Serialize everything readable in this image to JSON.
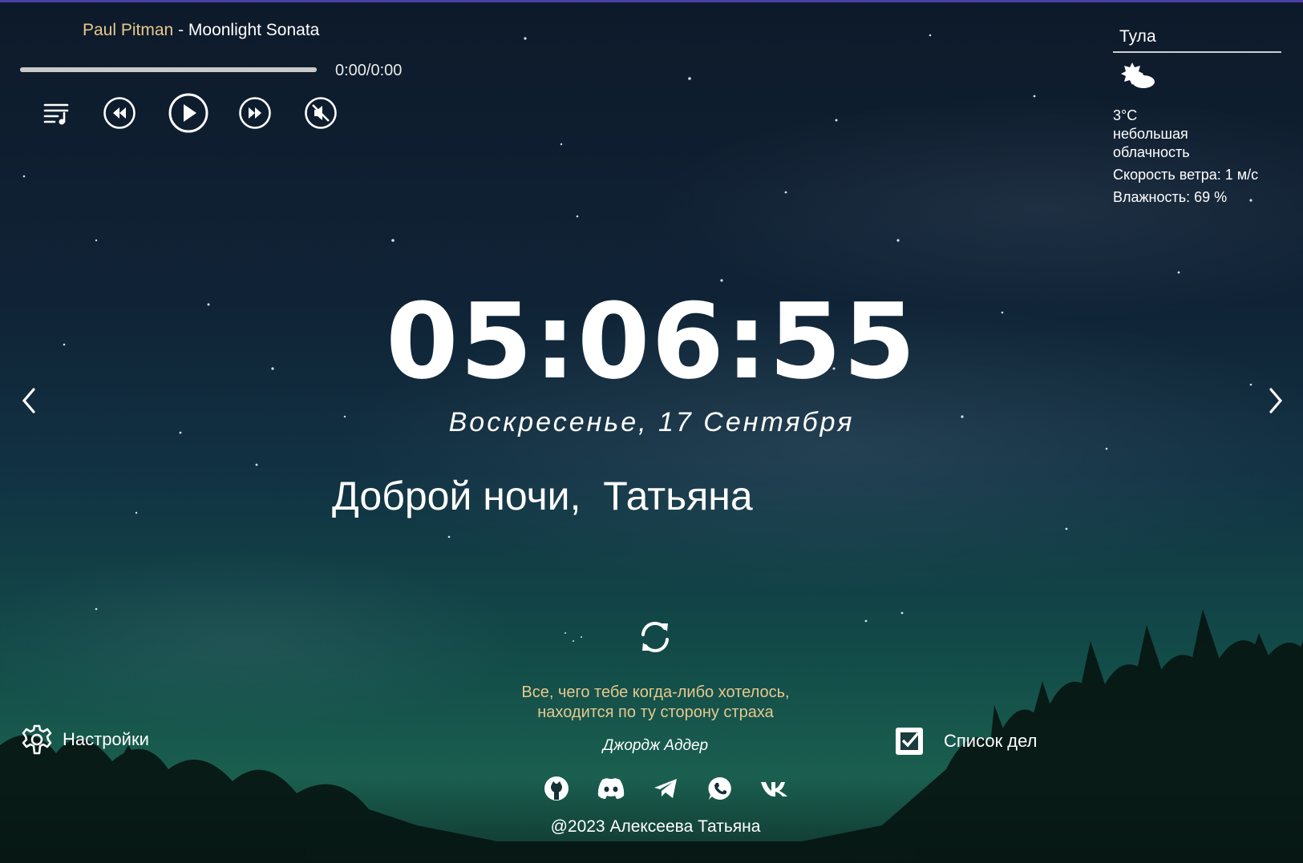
{
  "player": {
    "artist": "Paul Pitman",
    "separator": " - ",
    "song": "Moonlight Sonata",
    "time": "0:00/0:00",
    "progress_fraction": 1.0,
    "icons": [
      "playlist-icon",
      "rewind-icon",
      "play-icon",
      "fast-forward-icon",
      "mute-icon"
    ]
  },
  "weather": {
    "city": "Тула",
    "icon": "partly-cloudy-night-icon",
    "temperature": "3°C",
    "description_line1": "небольшая",
    "description_line2": "облачность",
    "wind": "Скорость ветра: 1 м/с",
    "humidity": "Влажность: 69 %"
  },
  "clock": {
    "time": "05:06:55",
    "date": "Воскресенье, 17 Сентября"
  },
  "greeting": {
    "text": "Доброй ночи,  Татьяна"
  },
  "slider": {
    "prev_icon": "chevron-left-icon",
    "next_icon": "chevron-right-icon"
  },
  "quote": {
    "line1": "Все, чего тебе когда-либо хотелось,",
    "line2": "находится по ту сторону страха",
    "author": "Джордж Аддер",
    "refresh_icon": "refresh-icon"
  },
  "settings": {
    "label": "Настройки",
    "icon": "gear-icon"
  },
  "todo": {
    "label": "Список дел",
    "icon": "checkbox-icon"
  },
  "socials": [
    "github-icon",
    "discord-icon",
    "telegram-icon",
    "whatsapp-icon",
    "vk-icon"
  ],
  "footer": {
    "copyright": "@2023 Алексеева Татьяна"
  },
  "colors": {
    "accent": "#e7c88e",
    "text": "#ffffff",
    "top_line": "#4a3fa8"
  }
}
